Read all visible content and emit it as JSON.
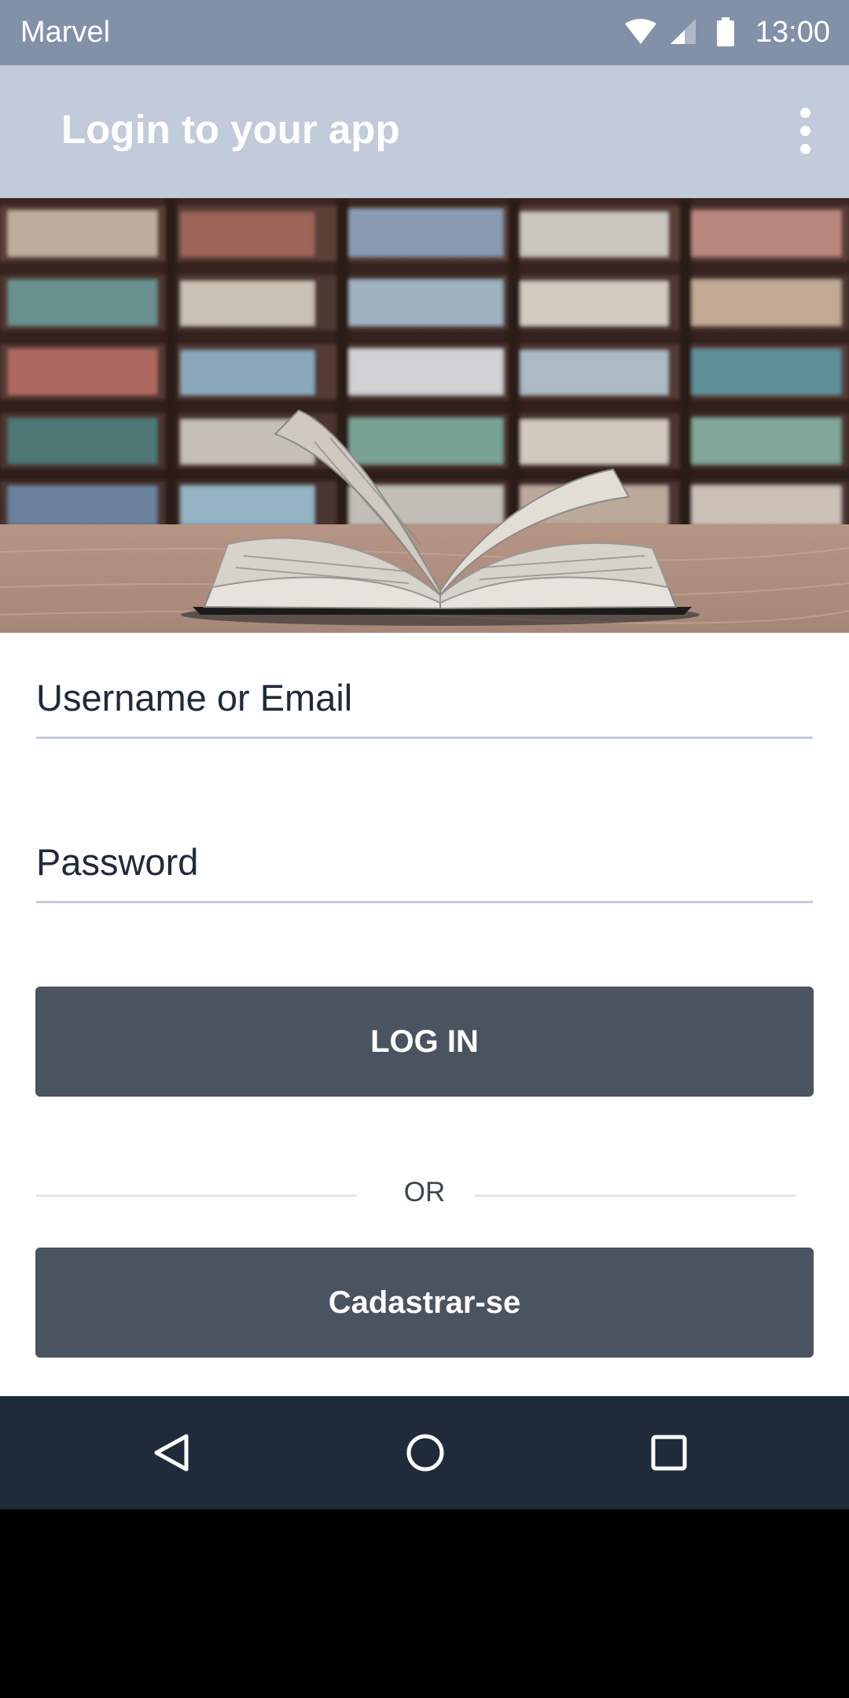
{
  "status_bar": {
    "carrier": "Marvel",
    "time": "13:00",
    "icons": [
      "wifi-icon",
      "signal-icon",
      "battery-icon"
    ]
  },
  "app_bar": {
    "title": "Login to your app",
    "menu_icon": "more-vert-icon"
  },
  "hero": {
    "image": "open book on wooden table in front of bookshelves"
  },
  "form": {
    "username_placeholder": "Username or Email",
    "password_placeholder": "Password",
    "login_label": "LOG IN",
    "divider_text": "OR",
    "signup_label": "Cadastrar-se"
  },
  "nav_bar": {
    "icons": [
      "back-icon",
      "home-icon",
      "recents-icon"
    ]
  },
  "colors": {
    "status_bar": "#8290a8",
    "app_bar": "#c1cbdb",
    "button": "#4a5360",
    "nav_bar": "#1f2b3b"
  }
}
